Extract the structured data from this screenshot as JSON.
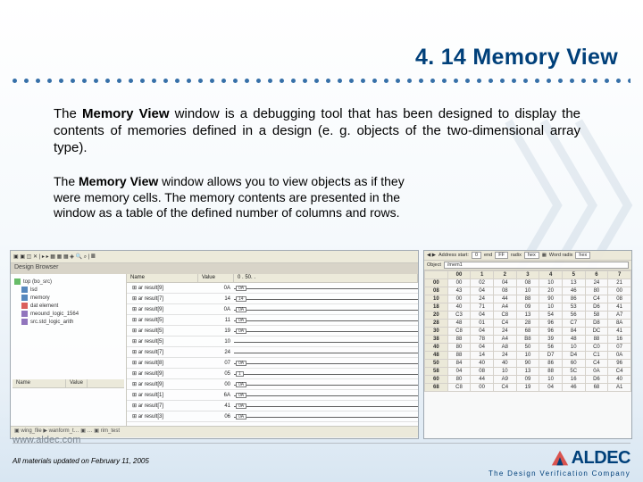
{
  "title": "4. 14 Memory View",
  "para1_pre": "The ",
  "para1_bold": "Memory View",
  "para1_post": " window is a debugging tool that has been designed to display the contents of memories defined in a design (e. g. objects of the two-dimensional array type).",
  "para2_pre": "The ",
  "para2_bold": "Memory View",
  "para2_post": " window allows you to view objects as if they were memory cells. The memory contents are presented in the window as a table of the defined number of columns and rows.",
  "design_browser": {
    "title": "Design Browser",
    "root": "top (bo_src)",
    "items": [
      "lsd",
      "memory",
      "dat element",
      "meound_logic_1564",
      "src.std_logic_arith"
    ],
    "cols": {
      "name": "Name",
      "val": "Value"
    }
  },
  "wave": {
    "hdr": {
      "name": "Name",
      "val": "Value"
    },
    "rows": [
      {
        "n": "ar result[9]",
        "v": "0A",
        "s": "0A"
      },
      {
        "n": "ar result[7]",
        "v": "14",
        "s": "14"
      },
      {
        "n": "ar result[9]",
        "v": "0A",
        "s": "0A"
      },
      {
        "n": "ar result[5]",
        "v": "11",
        "s": "0A"
      },
      {
        "n": "ar result[5]",
        "v": "19",
        "s": "0A"
      },
      {
        "n": "ar result[5]",
        "v": "10",
        "s": ""
      },
      {
        "n": "ar result[7]",
        "v": "24",
        "s": ""
      },
      {
        "n": "ar result[8]",
        "v": "07",
        "s": "0A"
      },
      {
        "n": "ar result[9]",
        "v": "05",
        "s": "1"
      },
      {
        "n": "ar result[9]",
        "v": "00",
        "s": "0A"
      },
      {
        "n": "ar result[1]",
        "v": "6A",
        "s": "0A"
      },
      {
        "n": "ar result[7]",
        "v": "41",
        "s": "0A"
      },
      {
        "n": "ar result[3]",
        "v": "06",
        "s": "0A"
      }
    ],
    "bottom": "▣ wing_file  ▶ wanform_t…  ▣ …  ▣ rim_test"
  },
  "mem": {
    "labels": {
      "addr": "Address start:",
      "end": "end",
      "radix": "radix",
      "hex": "hex",
      "wordradix": "Word radix",
      "hex2": "hex"
    },
    "addr_start": "0",
    "addr_end": "FF",
    "radix": "hex",
    "object_label": "Object",
    "object": "/mem1",
    "cols": [
      "",
      "00",
      "1",
      "2",
      "3",
      "4",
      "5",
      "6",
      "7"
    ],
    "rows": [
      [
        "00",
        "00",
        "02",
        "04",
        "08",
        "10",
        "13",
        "24",
        "21"
      ],
      [
        "08",
        "43",
        "04",
        "08",
        "10",
        "20",
        "46",
        "80",
        "00"
      ],
      [
        "10",
        "00",
        "24",
        "44",
        "88",
        "90",
        "86",
        "C4",
        "08"
      ],
      [
        "18",
        "40",
        "71",
        "A4",
        "09",
        "10",
        "53",
        "D6",
        "41"
      ],
      [
        "20",
        "C3",
        "04",
        "C8",
        "13",
        "54",
        "56",
        "58",
        "A7"
      ],
      [
        "28",
        "48",
        "01",
        "C4",
        "28",
        "96",
        "C7",
        "D8",
        "8A"
      ],
      [
        "30",
        "C8",
        "04",
        "24",
        "68",
        "96",
        "84",
        "DC",
        "41"
      ],
      [
        "38",
        "88",
        "78",
        "A4",
        "B8",
        "39",
        "48",
        "88",
        "16"
      ],
      [
        "40",
        "80",
        "04",
        "A8",
        "50",
        "56",
        "10",
        "C0",
        "07"
      ],
      [
        "48",
        "88",
        "14",
        "24",
        "10",
        "D7",
        "D4",
        "C1",
        "0A"
      ],
      [
        "50",
        "84",
        "40",
        "40",
        "90",
        "86",
        "60",
        "C4",
        "96"
      ],
      [
        "58",
        "04",
        "08",
        "10",
        "13",
        "88",
        "5C",
        "0A",
        "C4"
      ],
      [
        "60",
        "80",
        "44",
        "A9",
        "09",
        "10",
        "16",
        "D6",
        "40"
      ],
      [
        "68",
        "C8",
        "00",
        "C4",
        "19",
        "04",
        "46",
        "68",
        "A1"
      ]
    ]
  },
  "footer": {
    "url": "www.aldec.com",
    "updated": "All materials updated on February 11, 2005",
    "logo": "ALDEC",
    "tagline": "The Design Verification Company"
  }
}
